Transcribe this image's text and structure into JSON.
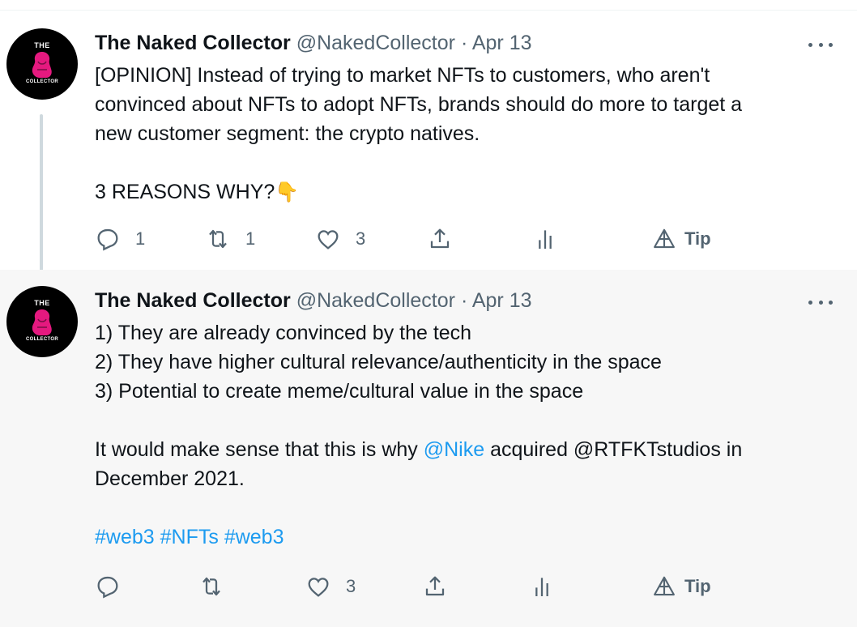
{
  "tweets": [
    {
      "avatar": {
        "top_text": "THE",
        "bottom_text": "COLLECTOR"
      },
      "name": "The Naked Collector",
      "handle": "@NakedCollector",
      "separator": "·",
      "date": "Apr 13",
      "lines": [
        "[OPINION] Instead of trying to market NFTs to customers, who aren't",
        "convinced about NFTs to adopt NFTs, brands should do more to target a",
        "new customer segment: the crypto natives.",
        "",
        "3 REASONS WHY?"
      ],
      "emoji": "👇",
      "actions": {
        "replies": "1",
        "retweets": "1",
        "likes": "3",
        "tip_label": "Tip"
      }
    },
    {
      "avatar": {
        "top_text": "THE",
        "bottom_text": "COLLECTOR"
      },
      "name": "The Naked Collector",
      "handle": "@NakedCollector",
      "separator": "·",
      "date": "Apr 13",
      "lines": [
        "1) They are already convinced by the tech",
        "2) They have higher cultural relevance/authenticity in the space",
        "3) Potential to create meme/cultural value in the space",
        ""
      ],
      "line5_before": "It would make sense that this is why ",
      "mention": "@Nike",
      "line5_after": " acquired @RTFKTstudios in",
      "line6": "December 2021.",
      "hashtags": [
        "#web3",
        "#NFTs",
        "#web3"
      ],
      "actions": {
        "replies": "",
        "retweets": "",
        "likes": "3",
        "tip_label": "Tip"
      }
    }
  ],
  "colors": {
    "text": "#0f1419",
    "muted": "#536471",
    "link": "#1d9bf0",
    "avatar_figure": "#e5197f",
    "thread_line": "#cfd9de",
    "second_tweet_bg": "#f7f7f7"
  },
  "icons": [
    "reply-icon",
    "retweet-icon",
    "like-icon",
    "share-icon",
    "analytics-icon",
    "tip-icon",
    "more-icon"
  ]
}
